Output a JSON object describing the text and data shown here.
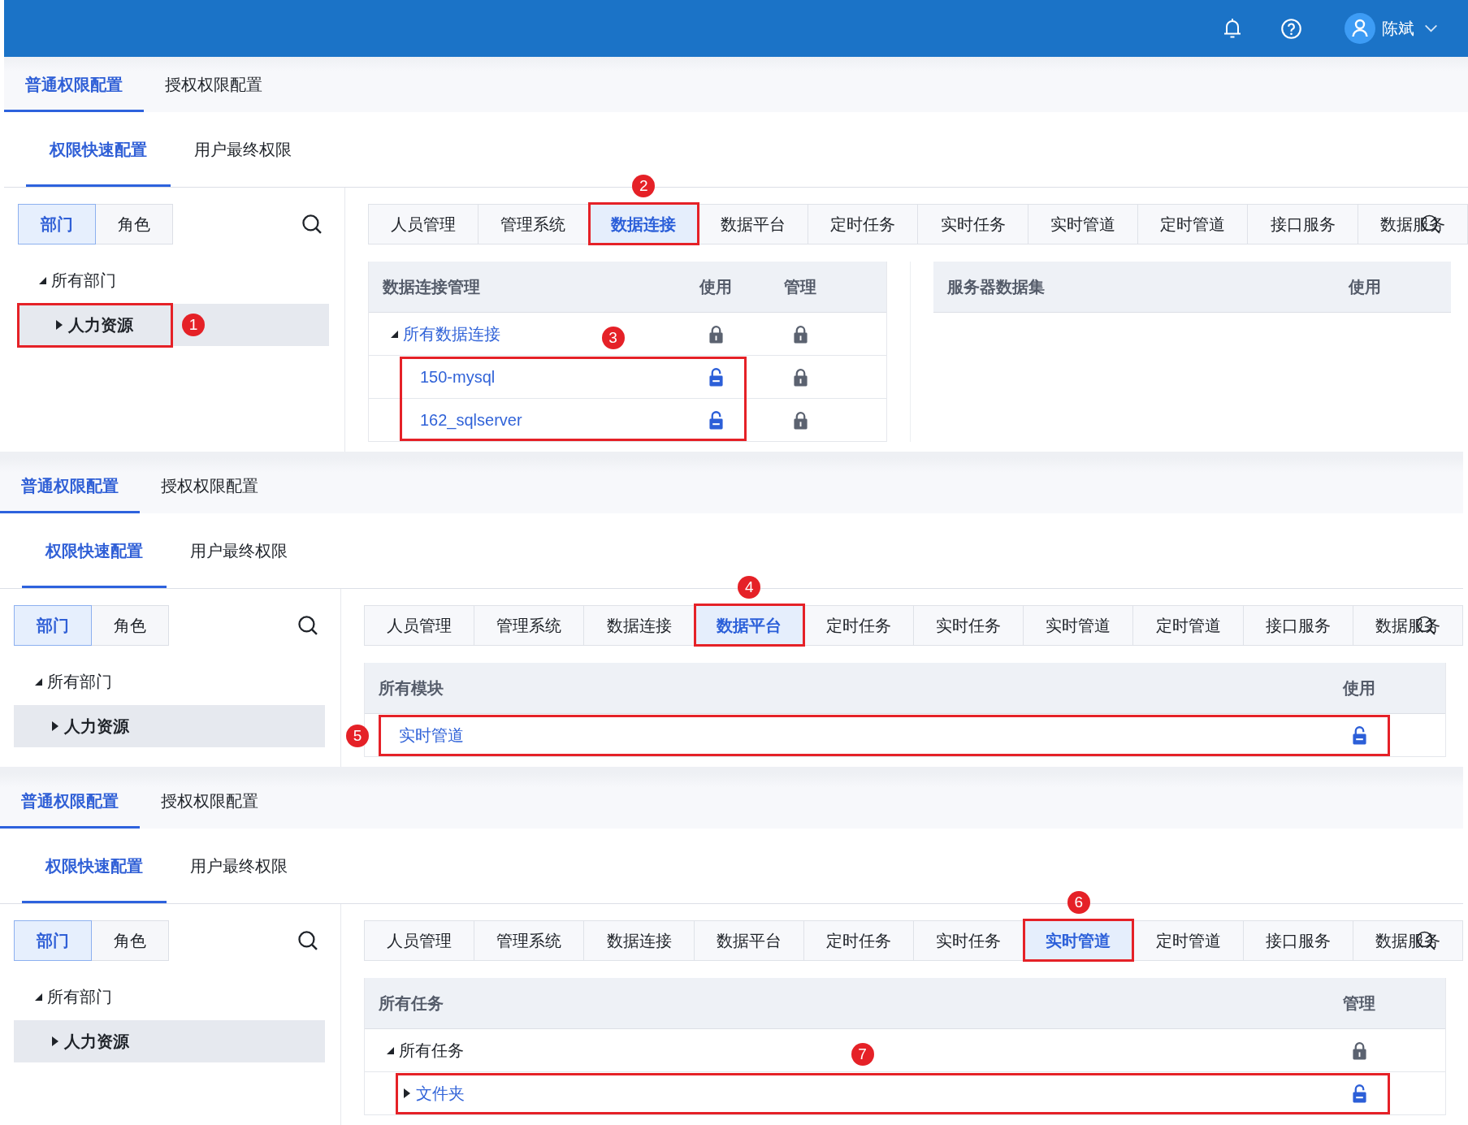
{
  "top_bar": {
    "user_name": "陈斌"
  },
  "panels": [
    {
      "main_tabs": [
        {
          "label": "普通权限配置",
          "selected": true
        },
        {
          "label": "授权权限配置",
          "selected": false
        }
      ],
      "sub_tabs": [
        {
          "label": "权限快速配置",
          "selected": true
        },
        {
          "label": "用户最终权限",
          "selected": false
        }
      ],
      "scope_toggle": [
        {
          "label": "部门",
          "selected": true
        },
        {
          "label": "角色",
          "selected": false
        }
      ],
      "tree": [
        {
          "label": "所有部门",
          "expanded": true,
          "selected": false,
          "marked": false,
          "children": [
            {
              "label": "人力资源",
              "expanded": false,
              "selected": true,
              "marked": true,
              "callout": "1"
            }
          ]
        }
      ],
      "module_tabs": [
        {
          "label": "人员管理",
          "selected": false,
          "marked": false
        },
        {
          "label": "管理系统",
          "selected": false,
          "marked": false
        },
        {
          "label": "数据连接",
          "selected": true,
          "marked": true,
          "callout": "2"
        },
        {
          "label": "数据平台",
          "selected": false,
          "marked": false
        },
        {
          "label": "定时任务",
          "selected": false,
          "marked": false
        },
        {
          "label": "实时任务",
          "selected": false,
          "marked": false
        },
        {
          "label": "实时管道",
          "selected": false,
          "marked": false
        },
        {
          "label": "定时管道",
          "selected": false,
          "marked": false
        },
        {
          "label": "接口服务",
          "selected": false,
          "marked": false
        },
        {
          "label": "数据服务",
          "selected": false,
          "marked": false
        }
      ],
      "tables": [
        {
          "columns": [
            "数据连接管理",
            "使用",
            "管理"
          ],
          "rows": [
            {
              "label": "所有数据连接",
              "kind": "folder",
              "expanded": true,
              "active": true,
              "marked": false,
              "permissions": [
                {
                  "locked": true
                },
                {
                  "locked": true
                }
              ],
              "children": [
                {
                  "label": "150-mysql",
                  "kind": "item",
                  "active": true,
                  "marked": true,
                  "callout": "3",
                  "permissions": [
                    {
                      "locked": false
                    },
                    {
                      "locked": true
                    }
                  ]
                },
                {
                  "label": "162_sqlserver",
                  "kind": "item",
                  "active": true,
                  "marked": true,
                  "permissions": [
                    {
                      "locked": false
                    },
                    {
                      "locked": true
                    }
                  ]
                }
              ]
            }
          ]
        },
        {
          "columns": [
            "服务器数据集",
            "使用"
          ]
        }
      ]
    },
    {
      "main_tabs": [
        {
          "label": "普通权限配置",
          "selected": true
        },
        {
          "label": "授权权限配置",
          "selected": false
        }
      ],
      "sub_tabs": [
        {
          "label": "权限快速配置",
          "selected": true
        },
        {
          "label": "用户最终权限",
          "selected": false
        }
      ],
      "scope_toggle": [
        {
          "label": "部门",
          "selected": true
        },
        {
          "label": "角色",
          "selected": false
        }
      ],
      "tree": [
        {
          "label": "所有部门",
          "expanded": true,
          "selected": false,
          "marked": false,
          "children": [
            {
              "label": "人力资源",
              "expanded": false,
              "selected": true,
              "marked": false
            }
          ]
        }
      ],
      "module_tabs": [
        {
          "label": "人员管理",
          "selected": false,
          "marked": false
        },
        {
          "label": "管理系统",
          "selected": false,
          "marked": false
        },
        {
          "label": "数据连接",
          "selected": false,
          "marked": false
        },
        {
          "label": "数据平台",
          "selected": true,
          "marked": true,
          "callout": "4"
        },
        {
          "label": "定时任务",
          "selected": false,
          "marked": false
        },
        {
          "label": "实时任务",
          "selected": false,
          "marked": false
        },
        {
          "label": "实时管道",
          "selected": false,
          "marked": false
        },
        {
          "label": "定时管道",
          "selected": false,
          "marked": false
        },
        {
          "label": "接口服务",
          "selected": false,
          "marked": false
        },
        {
          "label": "数据服务",
          "selected": false,
          "marked": false
        }
      ],
      "tables": [
        {
          "columns": [
            "所有模块",
            "使用"
          ],
          "rows": [
            {
              "label": "实时管道",
              "kind": "item",
              "active": true,
              "marked": true,
              "callout": "5",
              "permissions": [
                {
                  "locked": false
                }
              ]
            }
          ]
        }
      ]
    },
    {
      "main_tabs": [
        {
          "label": "普通权限配置",
          "selected": true
        },
        {
          "label": "授权权限配置",
          "selected": false
        }
      ],
      "sub_tabs": [
        {
          "label": "权限快速配置",
          "selected": true
        },
        {
          "label": "用户最终权限",
          "selected": false
        }
      ],
      "scope_toggle": [
        {
          "label": "部门",
          "selected": true
        },
        {
          "label": "角色",
          "selected": false
        }
      ],
      "tree": [
        {
          "label": "所有部门",
          "expanded": true,
          "selected": false,
          "marked": false,
          "children": [
            {
              "label": "人力资源",
              "expanded": false,
              "selected": true,
              "marked": false
            }
          ]
        }
      ],
      "module_tabs": [
        {
          "label": "人员管理",
          "selected": false,
          "marked": false
        },
        {
          "label": "管理系统",
          "selected": false,
          "marked": false
        },
        {
          "label": "数据连接",
          "selected": false,
          "marked": false
        },
        {
          "label": "数据平台",
          "selected": false,
          "marked": false
        },
        {
          "label": "定时任务",
          "selected": false,
          "marked": false
        },
        {
          "label": "实时任务",
          "selected": false,
          "marked": false
        },
        {
          "label": "实时管道",
          "selected": true,
          "marked": true,
          "callout": "6"
        },
        {
          "label": "定时管道",
          "selected": false,
          "marked": false
        },
        {
          "label": "接口服务",
          "selected": false,
          "marked": false
        },
        {
          "label": "数据服务",
          "selected": false,
          "marked": false
        }
      ],
      "tables": [
        {
          "columns": [
            "所有任务",
            "管理"
          ],
          "rows": [
            {
              "label": "所有任务",
              "kind": "folder",
              "expanded": true,
              "active": false,
              "marked": false,
              "permissions": [
                {
                  "locked": true
                }
              ],
              "children": [
                {
                  "label": "文件夹",
                  "kind": "folder",
                  "expanded": false,
                  "active": true,
                  "marked": true,
                  "callout": "7",
                  "permissions": [
                    {
                      "locked": false
                    }
                  ]
                }
              ]
            }
          ]
        }
      ]
    }
  ]
}
